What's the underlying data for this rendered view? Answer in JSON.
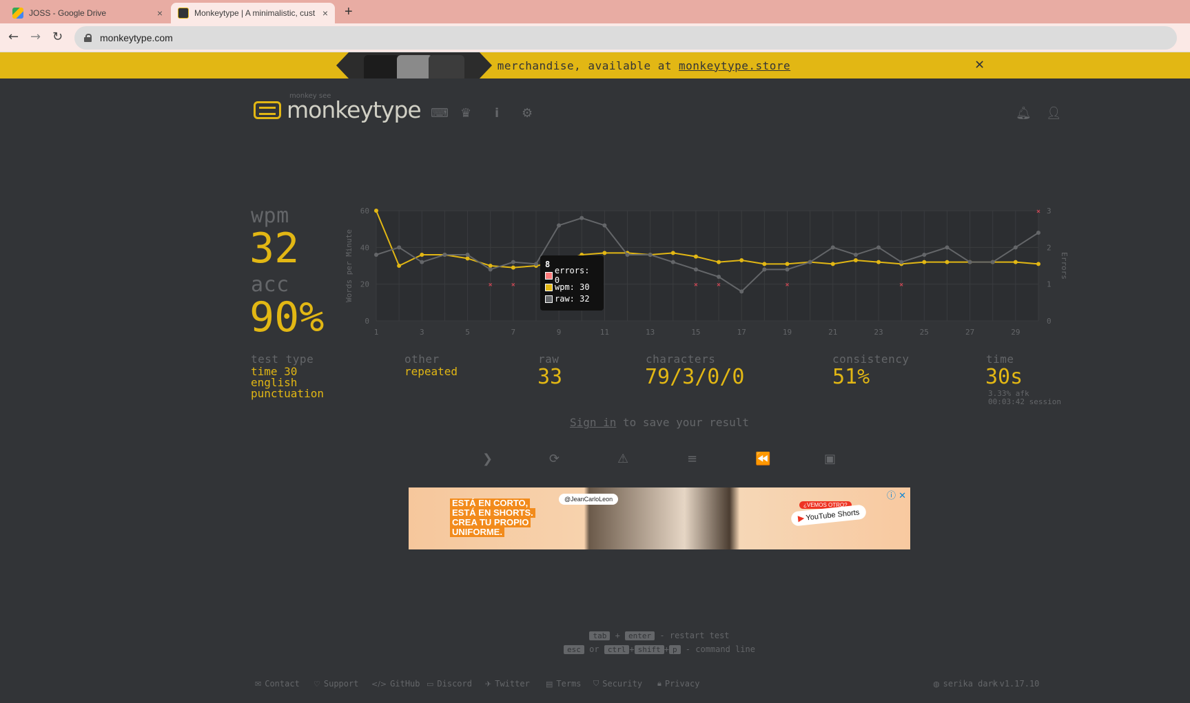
{
  "browser": {
    "tabs": [
      {
        "title": "JOSS - Google Drive",
        "close": "×"
      },
      {
        "title": "Monkeytype | A minimalistic, cust",
        "close": "×"
      }
    ],
    "new_tab": "+",
    "url": "monkeytype.com"
  },
  "banner": {
    "text": "Check out our merchandise, available at",
    "link": "monkeytype.store",
    "close": "✕"
  },
  "header": {
    "logo_sub": "monkey see",
    "logo_title": "monkeytype",
    "icons": [
      "keyboard-icon",
      "crown-icon",
      "info-icon",
      "settings-icon",
      "bell-icon",
      "user-icon"
    ]
  },
  "result": {
    "wpm_label": "wpm",
    "wpm": "32",
    "acc_label": "acc",
    "acc": "90%",
    "test_type_label": "test type",
    "test_type": [
      "time 30",
      "english",
      "punctuation"
    ],
    "other_label": "other",
    "other": "repeated",
    "raw_label": "raw",
    "raw": "33",
    "characters_label": "characters",
    "characters": "79/3/0/0",
    "consistency_label": "consistency",
    "consistency": "51%",
    "time_label": "time",
    "time": "30s",
    "afk": "3.33% afk",
    "session": "00:03:42 session"
  },
  "chart_data": {
    "type": "line",
    "x": [
      1,
      2,
      3,
      4,
      5,
      6,
      7,
      8,
      9,
      10,
      11,
      12,
      13,
      14,
      15,
      16,
      17,
      18,
      19,
      20,
      21,
      22,
      23,
      24,
      25,
      26,
      27,
      28,
      29,
      30
    ],
    "xticks": [
      "1",
      "3",
      "5",
      "7",
      "9",
      "11",
      "13",
      "15",
      "17",
      "19",
      "21",
      "23",
      "25",
      "27",
      "29"
    ],
    "ylabel": "Words per Minute",
    "y2label": "Errors",
    "ylim": [
      0,
      60
    ],
    "yticks": [
      "0",
      "20",
      "40",
      "60"
    ],
    "y2lim": [
      0,
      3
    ],
    "y2ticks": [
      "0",
      "1",
      "2",
      "3"
    ],
    "grid": true,
    "series": [
      {
        "name": "wpm",
        "color": "#e2b714",
        "values": [
          60,
          30,
          36,
          36,
          34,
          30,
          29,
          30,
          32,
          36,
          37,
          37,
          36,
          37,
          35,
          32,
          33,
          31,
          31,
          32,
          31,
          33,
          32,
          31,
          32,
          32,
          32,
          32,
          32,
          31
        ]
      },
      {
        "name": "raw",
        "color": "#646669",
        "values": [
          36,
          40,
          32,
          36,
          36,
          28,
          32,
          31,
          52,
          56,
          52,
          36,
          36,
          32,
          28,
          24,
          16,
          28,
          28,
          32,
          40,
          36,
          40,
          32,
          36,
          40,
          32,
          32,
          40,
          48
        ]
      },
      {
        "name": "errors",
        "color": "#ca4754",
        "points": [
          [
            6,
            1
          ],
          [
            7,
            1
          ],
          [
            15,
            1
          ],
          [
            16,
            1
          ],
          [
            19,
            1
          ],
          [
            24,
            1
          ],
          [
            30,
            3
          ]
        ]
      }
    ],
    "tooltip": {
      "title": "8",
      "errors": "errors: 0",
      "wpm": "wpm: 30",
      "raw": "raw: 32"
    }
  },
  "signin": {
    "link": "Sign in",
    "rest": " to save your result"
  },
  "actions": [
    "next-test",
    "restart",
    "report",
    "words-history",
    "replay",
    "screenshot"
  ],
  "ad": {
    "lines": [
      "ESTÁ EN CORTO,",
      "ESTÁ EN SHORTS.",
      "CREA TU PROPIO",
      "UNIFORME."
    ],
    "handle": "@JeanCarloLeon",
    "tag": "¿VEMOS OTRO?",
    "yt": "YouTube Shorts"
  },
  "shortcuts": {
    "tab": "tab",
    "plus": "+",
    "enter": "enter",
    "restart": "- restart test",
    "esc": "esc",
    "or": "or",
    "ctrl": "ctrl",
    "shift": "shift",
    "p": "p",
    "command": "- command line"
  },
  "footer": {
    "links": [
      "Contact",
      "Support",
      "GitHub",
      "Discord",
      "Twitter",
      "Terms",
      "Security",
      "Privacy"
    ],
    "theme": "serika dark",
    "version": "v1.17.10"
  },
  "colors": {
    "main": "#e2b714",
    "sub": "#646669",
    "bg": "#323437",
    "text": "#d1d0c5",
    "error": "#ca4754"
  }
}
